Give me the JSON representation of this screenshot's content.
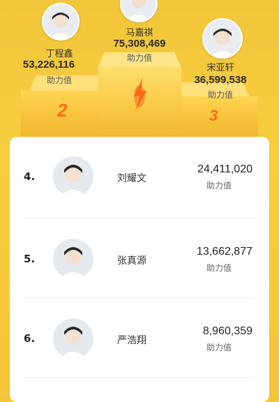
{
  "podium": {
    "first": {
      "name": "马嘉祺",
      "score": "75,308,469",
      "unit": "助力值"
    },
    "second": {
      "name": "丁程鑫",
      "score": "53,226,116",
      "unit": "助力值",
      "rank": "2"
    },
    "third": {
      "name": "宋亚轩",
      "score": "36,599,538",
      "unit": "助力值",
      "rank": "3"
    }
  },
  "list": [
    {
      "rank": "4.",
      "name": "刘耀文",
      "score": "24,411,020",
      "unit": "助力值"
    },
    {
      "rank": "5.",
      "name": "张真源",
      "score": "13,662,877",
      "unit": "助力值"
    },
    {
      "rank": "6.",
      "name": "严浩翔",
      "score": "8,960,359",
      "unit": "助力值"
    }
  ],
  "colors": {
    "background": "#f5c53a",
    "rank_accent": "#ff6a1a",
    "card": "#ffffff"
  }
}
